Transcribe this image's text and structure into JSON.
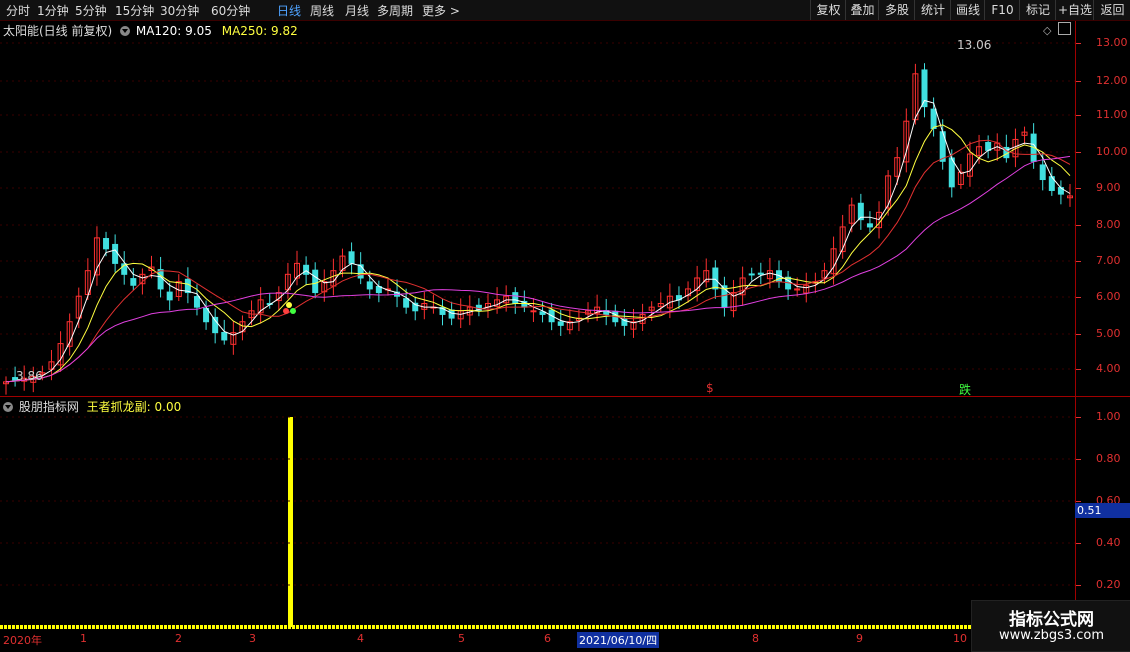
{
  "toolbar": {
    "periods": [
      "分时",
      "1分钟",
      "5分钟",
      "15分钟",
      "30分钟",
      "60分钟",
      "日线",
      "周线",
      "月线",
      "多周期",
      "更多"
    ],
    "active_index": 6,
    "right_buttons": [
      "复权",
      "叠加",
      "多股",
      "统计",
      "画线",
      "F10",
      "标记",
      "+自选",
      "返回"
    ]
  },
  "main_header": {
    "title": "太阳能(日线 前复权)",
    "ma120_label": "MA120: 9.05",
    "ma250_label": "MA250: 9.82"
  },
  "price_axis": {
    "labels": [
      "13.00",
      "12.00",
      "11.00",
      "10.00",
      "9.00",
      "8.00",
      "7.00",
      "6.00",
      "5.00",
      "4.00"
    ],
    "high_label": "13.06",
    "low_label": "3.86",
    "marker_s": "$",
    "marker_die": "跌"
  },
  "sub_header": {
    "title": "股朋指标网",
    "indicator_label": "王者抓龙副: 0.00"
  },
  "sub_axis": {
    "labels": [
      "1.00",
      "0.80",
      "0.60",
      "0.40",
      "0.20"
    ],
    "cursor_value": "0.51"
  },
  "x_axis": {
    "labels": [
      "2020年",
      "1",
      "2",
      "3",
      "4",
      "5",
      "6",
      "2021/06/10/四",
      "8",
      "9",
      "10"
    ]
  },
  "watermark": {
    "line1": "指标公式网",
    "line2": "www.zbgs3.com"
  },
  "colors": {
    "up": "#ff3030",
    "down": "#40e0e0",
    "ma_white": "#ffffff",
    "ma_yellow": "#ffff40",
    "ma_red": "#e03030",
    "ma_magenta": "#e040e0",
    "signal": "#ffff00"
  },
  "chart_data": {
    "type": "candlestick",
    "ylim": [
      3.7,
      13.3
    ],
    "price_closes": [
      3.95,
      4.0,
      4.05,
      4.1,
      4.2,
      4.5,
      5.0,
      5.6,
      6.3,
      7.0,
      7.9,
      7.6,
      7.2,
      6.9,
      6.6,
      6.9,
      7.1,
      6.5,
      6.2,
      6.7,
      6.4,
      6.0,
      5.6,
      5.3,
      5.1,
      5.3,
      5.6,
      5.9,
      6.2,
      6.1,
      6.4,
      6.9,
      7.2,
      6.9,
      6.4,
      6.7,
      7.0,
      7.4,
      7.2,
      6.8,
      6.5,
      6.4,
      6.5,
      6.3,
      6.0,
      5.9,
      6.1,
      6.0,
      5.8,
      5.7,
      5.9,
      6.0,
      5.9,
      6.1,
      6.2,
      6.3,
      6.1,
      6.0,
      5.9,
      5.8,
      5.6,
      5.5,
      5.6,
      5.7,
      5.9,
      6.0,
      5.8,
      5.6,
      5.5,
      5.6,
      5.8,
      6.0,
      6.1,
      6.3,
      6.2,
      6.5,
      6.8,
      7.0,
      6.5,
      6.0,
      6.4,
      6.8,
      6.9,
      6.9,
      7.0,
      6.7,
      6.5,
      6.5,
      6.6,
      6.7,
      7.0,
      7.6,
      8.2,
      8.8,
      8.4,
      8.2,
      8.6,
      9.6,
      10.1,
      11.1,
      12.4,
      11.5,
      10.9,
      10.0,
      9.3,
      9.7,
      10.2,
      10.4,
      10.3,
      10.5,
      10.1,
      10.6,
      10.8,
      10.0,
      9.5,
      9.2,
      9.1,
      9.05
    ]
  }
}
